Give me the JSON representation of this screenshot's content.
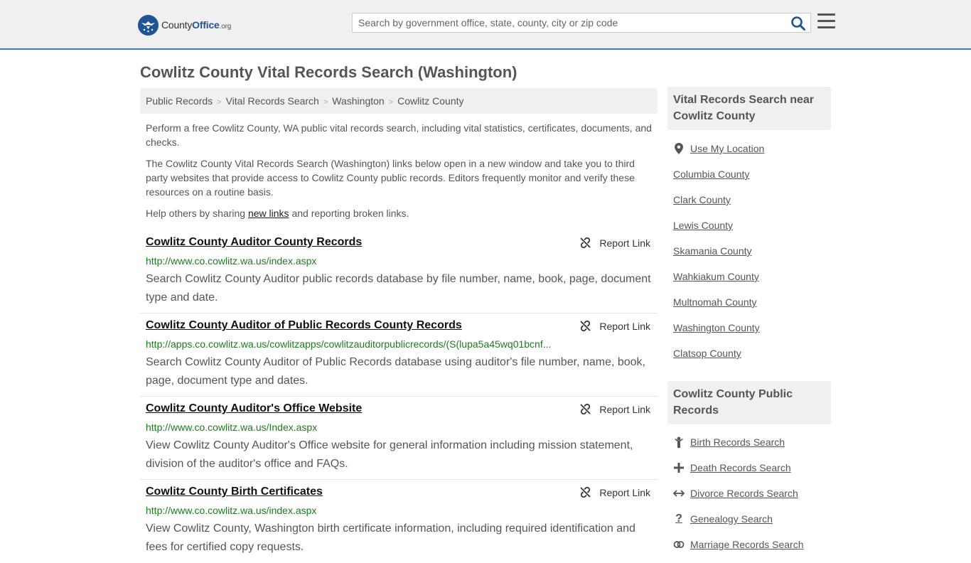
{
  "header": {
    "logo": {
      "brand_a": "County",
      "brand_b": "Office",
      "brand_c": ".org"
    },
    "search_placeholder": "Search by government office, state, county, city or zip code"
  },
  "page_title": "Cowlitz County Vital Records Search (Washington)",
  "breadcrumb": [
    "Public Records",
    "Vital Records Search",
    "Washington",
    "Cowlitz County"
  ],
  "intro": {
    "p1": "Perform a free Cowlitz County, WA public vital records search, including vital statistics, certificates, documents, and checks.",
    "p2": "The Cowlitz County Vital Records Search (Washington) links below open in a new window and take you to third party websites that provide access to Cowlitz County public records. Editors frequently monitor and verify these resources on a routine basis.",
    "p3_pre": "Help others by sharing ",
    "p3_link": "new links",
    "p3_post": " and reporting broken links."
  },
  "report_label": "Report Link",
  "results": [
    {
      "title": "Cowlitz County Auditor County Records",
      "url": "http://www.co.cowlitz.wa.us/index.aspx",
      "desc": "Search Cowlitz County Auditor public records database by file number, name, book, page, document type and date."
    },
    {
      "title": "Cowlitz County Auditor of Public Records County Records",
      "url": "http://apps.co.cowlitz.wa.us/cowlitzapps/cowlitzauditorpublicrecords/(S(lupa5a45wq01bcnf...",
      "desc": "Search Cowlitz County Auditor of Public Records database using auditor's file number, name, book, page, document type and dates."
    },
    {
      "title": "Cowlitz County Auditor's Office Website",
      "url": "http://www.co.cowlitz.wa.us/Index.aspx",
      "desc": "View Cowlitz County Auditor's Office website for general information including mission statement, division of the auditor's office and FAQs."
    },
    {
      "title": "Cowlitz County Birth Certificates",
      "url": "http://www.co.cowlitz.wa.us/index.aspx",
      "desc": "View Cowlitz County, Washington birth certificate information, including required identification and fees for certified copy requests."
    }
  ],
  "sidebar": {
    "nearby_heading": "Vital Records Search near Cowlitz County",
    "use_location": "Use My Location",
    "nearby": [
      "Columbia County",
      "Clark County",
      "Lewis County",
      "Skamania County",
      "Wahkiakum County",
      "Multnomah County",
      "Washington County",
      "Clatsop County"
    ],
    "public_heading": "Cowlitz County Public Records",
    "public_links": [
      {
        "label": "Birth Records Search",
        "icon": "birth-icon"
      },
      {
        "label": "Death Records Search",
        "icon": "cross-icon"
      },
      {
        "label": "Divorce Records Search",
        "icon": "arrows-icon"
      },
      {
        "label": "Genealogy Search",
        "icon": "question-icon"
      },
      {
        "label": "Marriage Records Search",
        "icon": "rings-icon"
      }
    ]
  }
}
